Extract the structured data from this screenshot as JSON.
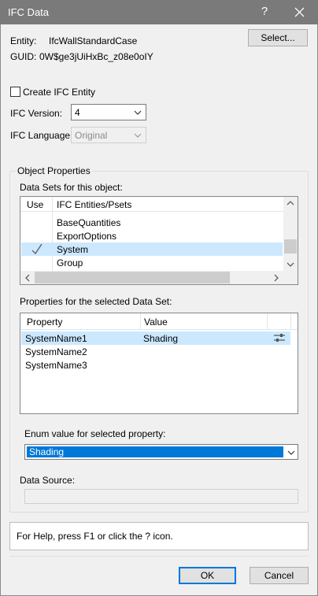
{
  "window": {
    "title": "IFC Data",
    "help_symbol": "?"
  },
  "entity": {
    "label": "Entity:",
    "value": "IfcWallStandardCase"
  },
  "guid": {
    "label": "GUID:",
    "value": "0W$ge3jUiHxBc_z08e0oIY"
  },
  "select_button": "Select...",
  "create_entity": {
    "label": "Create IFC Entity",
    "checked": false
  },
  "ifc_version": {
    "label": "IFC Version:",
    "value": "4"
  },
  "ifc_language": {
    "label": "IFC Language:",
    "value": "Original"
  },
  "object_properties": {
    "title": "Object Properties",
    "data_sets_label": "Data Sets for this object:",
    "columns": [
      "Use",
      "IFC Entities/Psets"
    ],
    "rows": [
      {
        "name": "BaseQuantities",
        "checked": false,
        "selected": false
      },
      {
        "name": "ExportOptions",
        "checked": false,
        "selected": false
      },
      {
        "name": "System",
        "checked": true,
        "selected": true
      },
      {
        "name": "Group",
        "checked": false,
        "selected": false
      }
    ],
    "properties_label": "Properties for the selected Data Set:",
    "prop_columns": [
      "Property",
      "Value"
    ],
    "prop_rows": [
      {
        "name": "SystemName1",
        "value": "Shading",
        "selected": true
      },
      {
        "name": "SystemName2",
        "value": "",
        "selected": false
      },
      {
        "name": "SystemName3",
        "value": "",
        "selected": false
      }
    ],
    "enum_label": "Enum value for selected property:",
    "enum_value": "Shading",
    "data_source_label": "Data Source:"
  },
  "help_text": "For Help, press F1 or click the ? icon.",
  "buttons": {
    "ok": "OK",
    "cancel": "Cancel"
  },
  "colors": {
    "accent": "#0078d7",
    "selection": "#cce8ff",
    "titlebar": "#7a7a7a"
  }
}
